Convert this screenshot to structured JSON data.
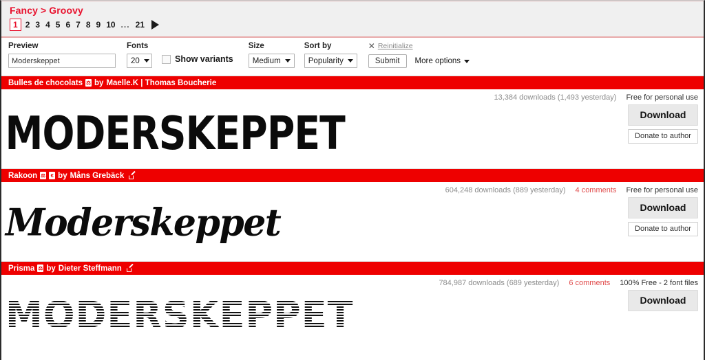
{
  "breadcrumb": {
    "parent": "Fancy",
    "separator": ">",
    "current": "Groovy",
    "full": "Fancy > Groovy"
  },
  "pagination": {
    "pages": [
      "1",
      "2",
      "3",
      "4",
      "5",
      "6",
      "7",
      "8",
      "9",
      "10",
      "...",
      "21"
    ],
    "current": "1",
    "next_icon": "next-arrow-icon"
  },
  "toolbar": {
    "preview": {
      "label": "Preview",
      "value": "Moderskeppet",
      "placeholder": "Moderskeppet"
    },
    "fonts": {
      "label": "Fonts",
      "value": "20"
    },
    "show_variants": {
      "label": "Show variants",
      "checked": false
    },
    "size": {
      "label": "Size",
      "value": "Medium"
    },
    "sort_by": {
      "label": "Sort by",
      "value": "Popularity"
    },
    "reinitialize": {
      "icon": "close-x-icon",
      "label": "Reinitialize"
    },
    "submit_label": "Submit",
    "more_options_label": "More options"
  },
  "colors": {
    "brand_red": "#ee0000",
    "breadcrumb_red": "#e8112d",
    "comments_red": "#e04b4b",
    "band_gray": "#f0f0f0"
  },
  "fonts": [
    {
      "name": "Bulles de chocolats",
      "badges": [
        "zip-icon"
      ],
      "external_link": false,
      "by_prefix": "by",
      "authors": "Maelle.K | Thomas Boucherie",
      "downloads": "13,384 downloads (1,493 yesterday)",
      "comments": "",
      "license": "Free for personal use",
      "sample_text": "MODERSKEPPET",
      "download_label": "Download",
      "donate_label": "Donate to author"
    },
    {
      "name": "Rakoon",
      "badges": [
        "zip-icon",
        "euro-icon"
      ],
      "external_link": true,
      "by_prefix": "by",
      "authors": "Måns Grebäck",
      "downloads": "604,248 downloads (889 yesterday)",
      "comments": "4 comments",
      "license": "Free for personal use",
      "sample_text": "Moderskeppet",
      "download_label": "Download",
      "donate_label": "Donate to author"
    },
    {
      "name": "Prisma",
      "badges": [
        "zip-icon"
      ],
      "external_link": true,
      "by_prefix": "by",
      "authors": "Dieter Steffmann",
      "downloads": "784,987 downloads (689 yesterday)",
      "comments": "6 comments",
      "license": "100% Free - 2 font files",
      "sample_text": "MODERSKEPPET",
      "download_label": "Download",
      "donate_label": ""
    }
  ]
}
